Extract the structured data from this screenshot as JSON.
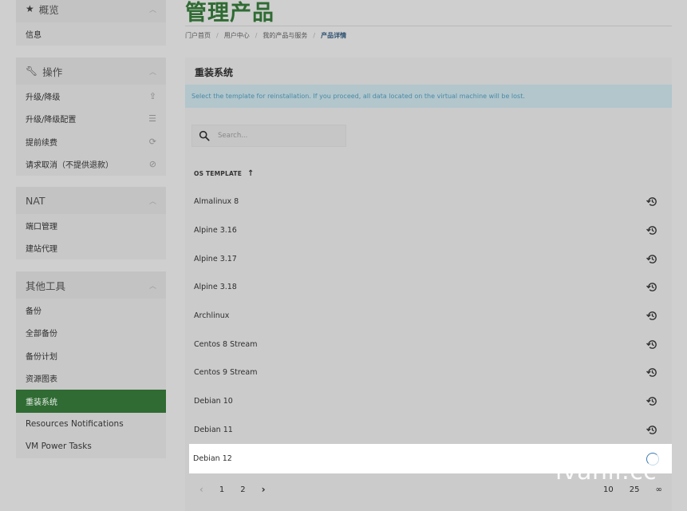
{
  "sidebar": {
    "overview": {
      "title": "概览",
      "items": [
        "信息"
      ]
    },
    "actions": {
      "title": "操作",
      "items": [
        "升级/降级",
        "升级/降级配置",
        "提前续费",
        "请求取消（不提供退款）"
      ]
    },
    "nat": {
      "title": "NAT",
      "items": [
        "端口管理",
        "建站代理"
      ]
    },
    "tools": {
      "title": "其他工具",
      "items": [
        "备份",
        "全部备份",
        "备份计划",
        "资源图表",
        "重装系统",
        "Resources Notifications",
        "VM Power Tasks"
      ]
    }
  },
  "main": {
    "page_title": "管理产品",
    "breadcrumb": [
      "门户首页",
      "用户中心",
      "我的产品与服务",
      "产品详情"
    ]
  },
  "reinstall": {
    "title": "重装系统",
    "alert": "Select the template for reinstallation. If you proceed, all data located on the virtual machine will be lost.",
    "search_placeholder": "Search...",
    "column_header": "OS TEMPLATE",
    "templates": [
      "Almalinux 8",
      "Alpine 3.16",
      "Alpine 3.17",
      "Alpine 3.18",
      "Archlinux",
      "Centos 8 Stream",
      "Centos 9 Stream",
      "Debian 10",
      "Debian 11",
      "Debian 12"
    ],
    "selected": "Debian 12",
    "pages": [
      "1",
      "2"
    ],
    "per_page": [
      "10",
      "25",
      "∞"
    ]
  },
  "watermark": "ivanli.cc",
  "colors": {
    "accent": "#2f6b33",
    "alert_bg": "#b2c6cc",
    "alert_text": "#4a8aa6"
  }
}
